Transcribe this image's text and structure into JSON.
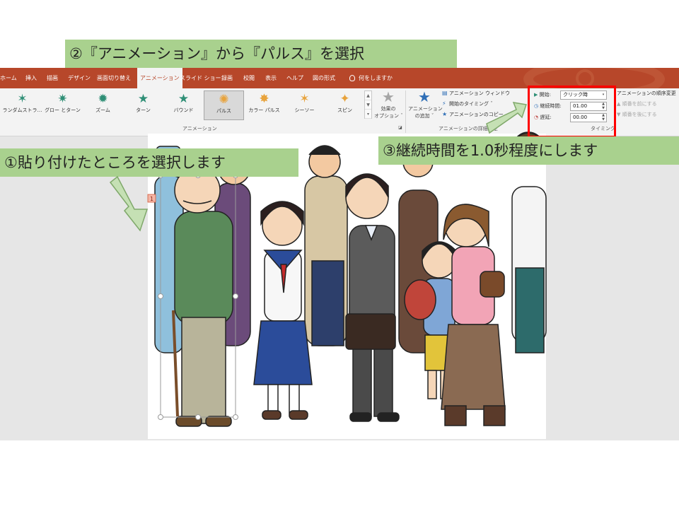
{
  "callouts": {
    "step1": "①貼り付けたところを選択します",
    "step2": "②『アニメーション』から『パルス』を選択",
    "step3": "③継続時間を1.0秒程度にします"
  },
  "ribbon_tabs": [
    "ホーム",
    "挿入",
    "描画",
    "デザイン",
    "画面切り替え",
    "アニメーション",
    "スライド ショー",
    "録画",
    "校閲",
    "表示",
    "ヘルプ",
    "図の形式",
    "何をしますか"
  ],
  "active_tab": "アニメーション",
  "effects": [
    {
      "label": "ランダムストラ…",
      "icon": "random-bars-icon"
    },
    {
      "label": "グロー とターン",
      "icon": "grow-turn-icon"
    },
    {
      "label": "ズーム",
      "icon": "zoom-icon"
    },
    {
      "label": "ターン",
      "icon": "swivel-icon"
    },
    {
      "label": "バウンド",
      "icon": "bounce-icon"
    },
    {
      "label": "パルス",
      "icon": "pulse-icon",
      "selected": true
    },
    {
      "label": "カラー パルス",
      "icon": "color-pulse-icon"
    },
    {
      "label": "シーソー",
      "icon": "teeter-icon"
    },
    {
      "label": "スピン",
      "icon": "spin-icon"
    }
  ],
  "effect_options_label": [
    "効果の",
    "オプション ˇ"
  ],
  "group_animation_label": "アニメーション",
  "add_animation_label": [
    "アニメーション",
    "の追加 ˇ"
  ],
  "advanced": {
    "pane": "アニメーション ウィンドウ",
    "trigger": "開始のタイミング ˇ",
    "painter": "アニメーションのコピー",
    "group_label": "アニメーションの詳細設定"
  },
  "timing": {
    "start_label": "開始:",
    "start_value": "クリック時",
    "duration_label": "継続時間:",
    "duration_value": "01.00",
    "delay_label": "遅延:",
    "delay_value": "00.00",
    "group_label": "タイミング"
  },
  "reorder": {
    "title": "アニメーションの順序変更",
    "earlier": "▲ 順番を前にする",
    "later": "▼ 順番を後にする"
  },
  "slide": {
    "animation_tag": "1"
  },
  "colors": {
    "ribbon_tab_bar": "#b7472a",
    "callout_green": "#a9d18e",
    "highlight_red": "#ff0000",
    "arrow_green": "#c5e0b4"
  }
}
